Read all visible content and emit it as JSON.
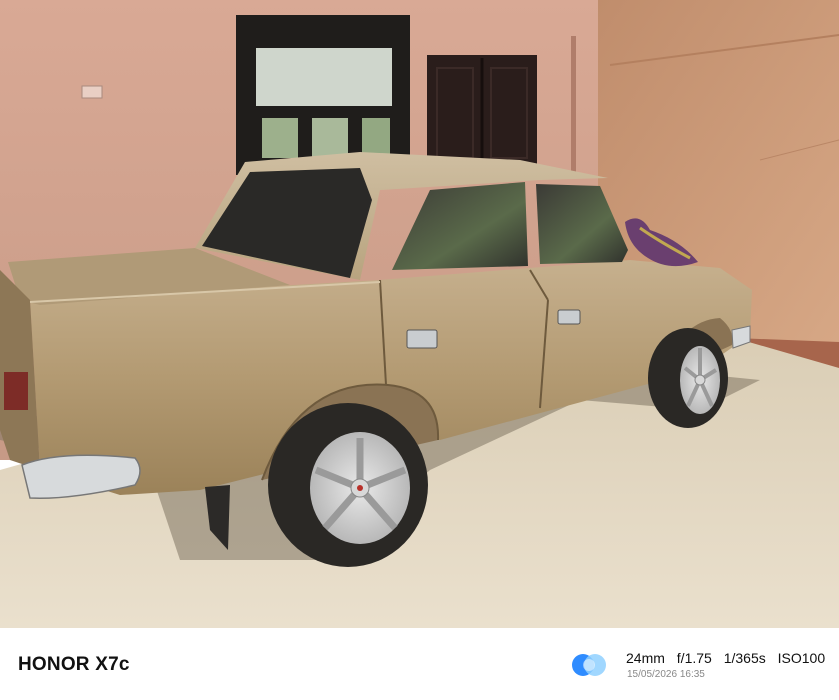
{
  "footer": {
    "brand": "HONOR X7c",
    "exif": {
      "focal_length": "24mm",
      "aperture": "f/1.75",
      "shutter": "1/365s",
      "iso": "ISO100"
    },
    "datetime": "15/05/2026 16:35"
  },
  "colors": {
    "logo_primary": "#2f8cff",
    "logo_secondary": "#8fd0ff"
  }
}
